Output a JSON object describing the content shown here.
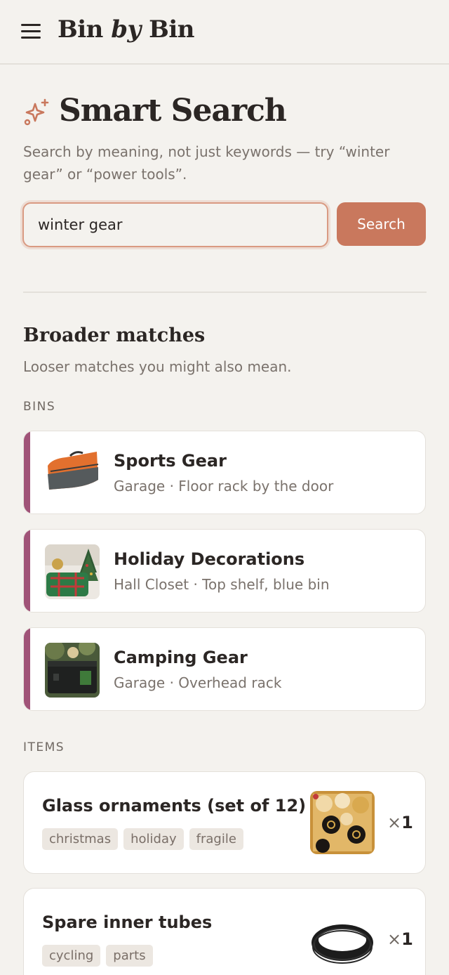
{
  "header": {
    "brand_part1": "Bin",
    "brand_part2": "by",
    "brand_part3": "Bin",
    "menu_icon": "hamburger-menu-icon"
  },
  "search": {
    "icon": "sparkle-icon",
    "title": "Smart Search",
    "subtitle": "Search by meaning, not just keywords — try “winter gear” or “power tools”.",
    "query": "winter gear",
    "button_label": "Search",
    "accent_color": "#c9785d"
  },
  "results": {
    "section_title": "Broader matches",
    "section_subtitle": "Looser matches you might also mean.",
    "bins_label": "BINS",
    "items_label": "ITEMS",
    "bins": [
      {
        "name": "Sports Gear",
        "location": "Garage · Floor rack by the door",
        "thumb": "duffel-bag-photo"
      },
      {
        "name": "Holiday Decorations",
        "location": "Hall Closet · Top shelf, blue bin",
        "thumb": "holiday-storage-bag-photo"
      },
      {
        "name": "Camping Gear",
        "location": "Garage · Overhead rack",
        "thumb": "camping-case-photo"
      }
    ],
    "items": [
      {
        "name": "Glass ornaments (set of 12)",
        "tags": [
          "christmas",
          "holiday",
          "fragile"
        ],
        "qty_prefix": "×",
        "qty": "1",
        "thumb": "ornaments-photo"
      },
      {
        "name": "Spare inner tubes",
        "tags": [
          "cycling",
          "parts"
        ],
        "qty_prefix": "×",
        "qty": "1",
        "thumb": "inner-tube-photo"
      }
    ],
    "bin_stripe_color": "#a05378"
  }
}
